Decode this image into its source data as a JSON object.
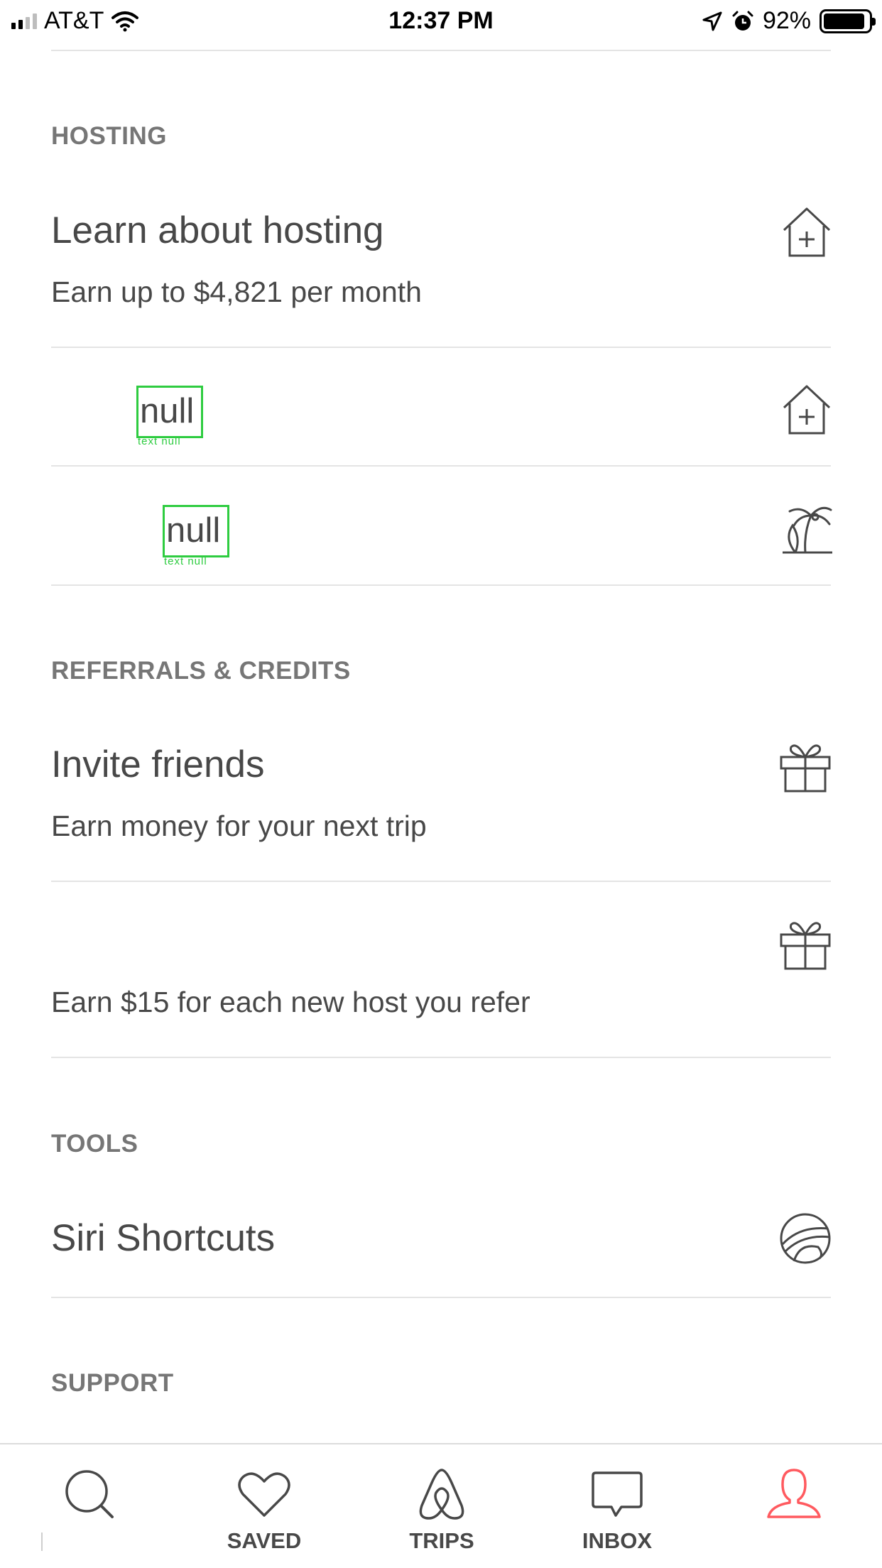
{
  "status_bar": {
    "carrier": "AT&T",
    "time": "12:37 PM",
    "battery_percent": "92%",
    "battery_level": 0.92,
    "icons": [
      "signal-icon",
      "wifi-icon",
      "location-arrow-icon",
      "alarm-icon",
      "battery-icon"
    ]
  },
  "sections": {
    "hosting": {
      "label": "HOSTING",
      "learn_title": "Learn about hosting",
      "learn_sub": "Earn up to $4,821 per month",
      "row2_text": "null",
      "row2_caption": "text null",
      "row3_text": "null",
      "row3_caption": "text null"
    },
    "referrals": {
      "label": "REFERRALS & CREDITS",
      "invite_title": "Invite friends",
      "invite_sub": "Earn money for your next trip",
      "host_sub": "Earn $15 for each new host you refer"
    },
    "tools": {
      "label": "TOOLS",
      "siri_title": "Siri Shortcuts"
    },
    "support": {
      "label": "SUPPORT"
    }
  },
  "tabbar": {
    "explore_label": "",
    "saved_label": "SAVED",
    "trips_label": "TRIPS",
    "inbox_label": "INBOX",
    "profile_label": "",
    "active_color": "#FF5A5F",
    "icon_color": "#484848",
    "green_box_color": "#2ECC40"
  }
}
